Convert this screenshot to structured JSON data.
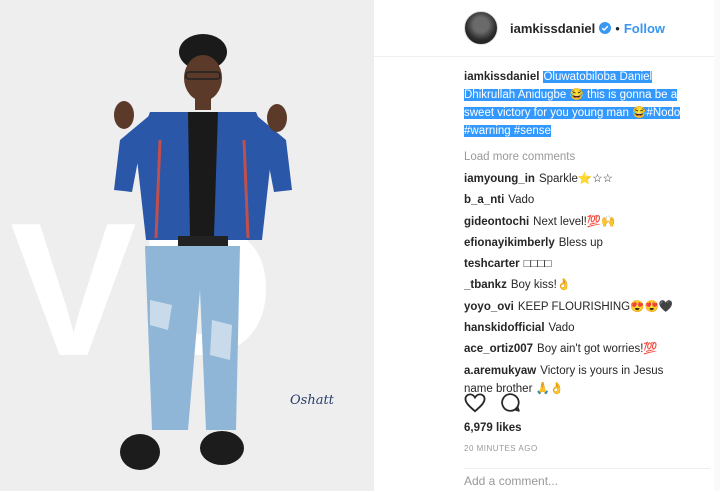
{
  "post": {
    "username": "iamkissdaniel",
    "follow_label": "Follow",
    "separator": "•",
    "photo_text": "VD",
    "photo_logo": "Oshatt",
    "caption_prefix": "iamkissdaniel",
    "caption_text": "Oluwatobiloba Daniel Dhikrullah Anidugbe 😂 this is gonna be a sweet victory for you young man 😂#Nodo #warning #sense",
    "load_more": "Load more comments",
    "comments": [
      {
        "user": "iamyoung_in",
        "text": "Sparkle⭐☆☆"
      },
      {
        "user": "b_a_nti",
        "text": "Vado"
      },
      {
        "user": "gideontochi",
        "text": "Next level!💯🙌"
      },
      {
        "user": "efionayikimberly",
        "text": "Bless up"
      },
      {
        "user": "teshcarter",
        "text": "□□□□"
      },
      {
        "user": "_tbankz",
        "text": "Boy kiss!👌"
      },
      {
        "user": "yoyo_ovi",
        "text": "KEEP FLOURISHING😍😍🖤"
      },
      {
        "user": "hanskidofficial",
        "text": "Vado"
      },
      {
        "user": "ace_ortiz007",
        "text": "Boy ain't got worries!💯"
      },
      {
        "user": "a.aremukyaw",
        "text": "Victory is yours in Jesus name brother 🙏👌"
      }
    ],
    "likes": "6,979 likes",
    "time": "20 MINUTES AGO",
    "add_comment_placeholder": "Add a comment..."
  },
  "colors": {
    "link_blue": "#3897f0",
    "selection": "#3399ff",
    "jacket": "#2a57a8",
    "jeans": "#8fb6d6"
  },
  "icons": [
    "verified-badge-icon",
    "heart-icon",
    "comment-icon"
  ]
}
